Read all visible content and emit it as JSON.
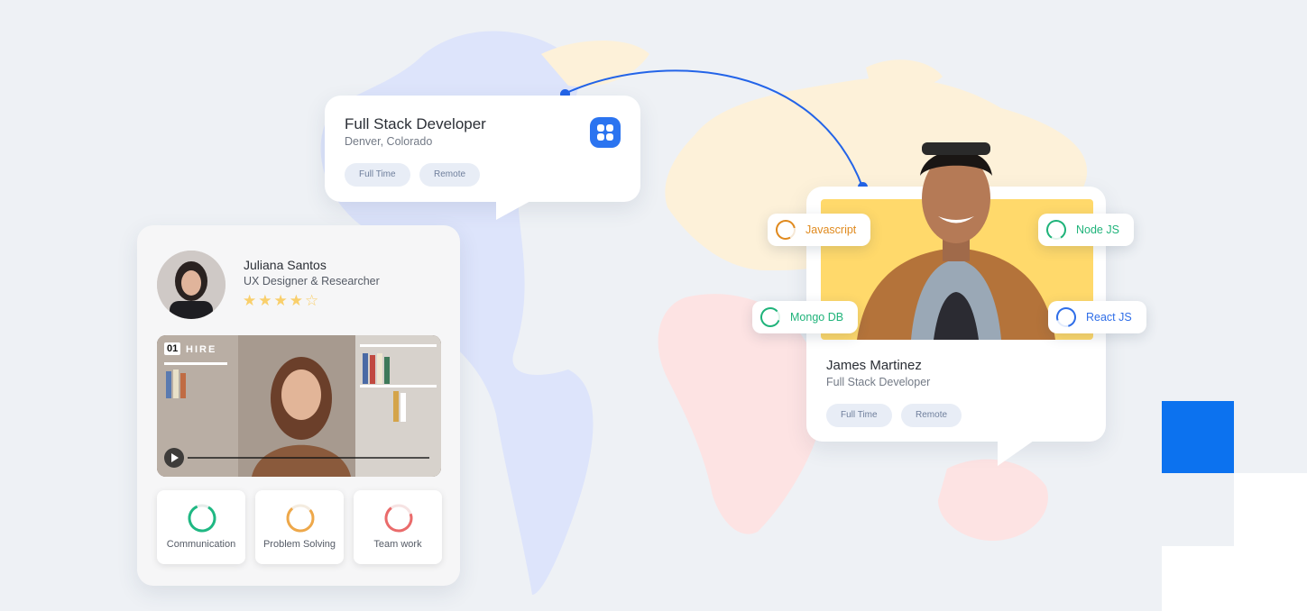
{
  "job_card": {
    "title": "Full Stack Developer",
    "location": "Denver, Colorado",
    "tags": [
      "Full Time",
      "Remote"
    ],
    "icon": "chat-grid-app-icon"
  },
  "candidate_card": {
    "name": "Juliana Santos",
    "role": "UX Designer & Researcher",
    "rating": 4,
    "rating_max": 5,
    "stars": "★★★★☆",
    "video": {
      "brand_number": "01",
      "brand_text": "HIRE",
      "progress": 0.0
    },
    "skills": [
      {
        "label": "Communication",
        "color": "#1fb883",
        "level": 0.85
      },
      {
        "label": "Problem Solving",
        "color": "#eea84a",
        "level": 0.75
      },
      {
        "label": "Team work",
        "color": "#ea6b6b",
        "level": 0.7
      }
    ]
  },
  "profile_card": {
    "name": "James Martinez",
    "role": "Full Stack Developer",
    "tags": [
      "Full Time",
      "Remote"
    ],
    "skill_tags": [
      {
        "label": "Javascript",
        "color": "#e08a1e"
      },
      {
        "label": "Node JS",
        "color": "#1fb37a"
      },
      {
        "label": "Mongo DB",
        "color": "#1fb37a"
      },
      {
        "label": "React JS",
        "color": "#2f6ee8"
      }
    ]
  },
  "colors": {
    "accent_blue": "#0c72ef",
    "connector": "#2364e8",
    "background": "#eef1f5"
  }
}
